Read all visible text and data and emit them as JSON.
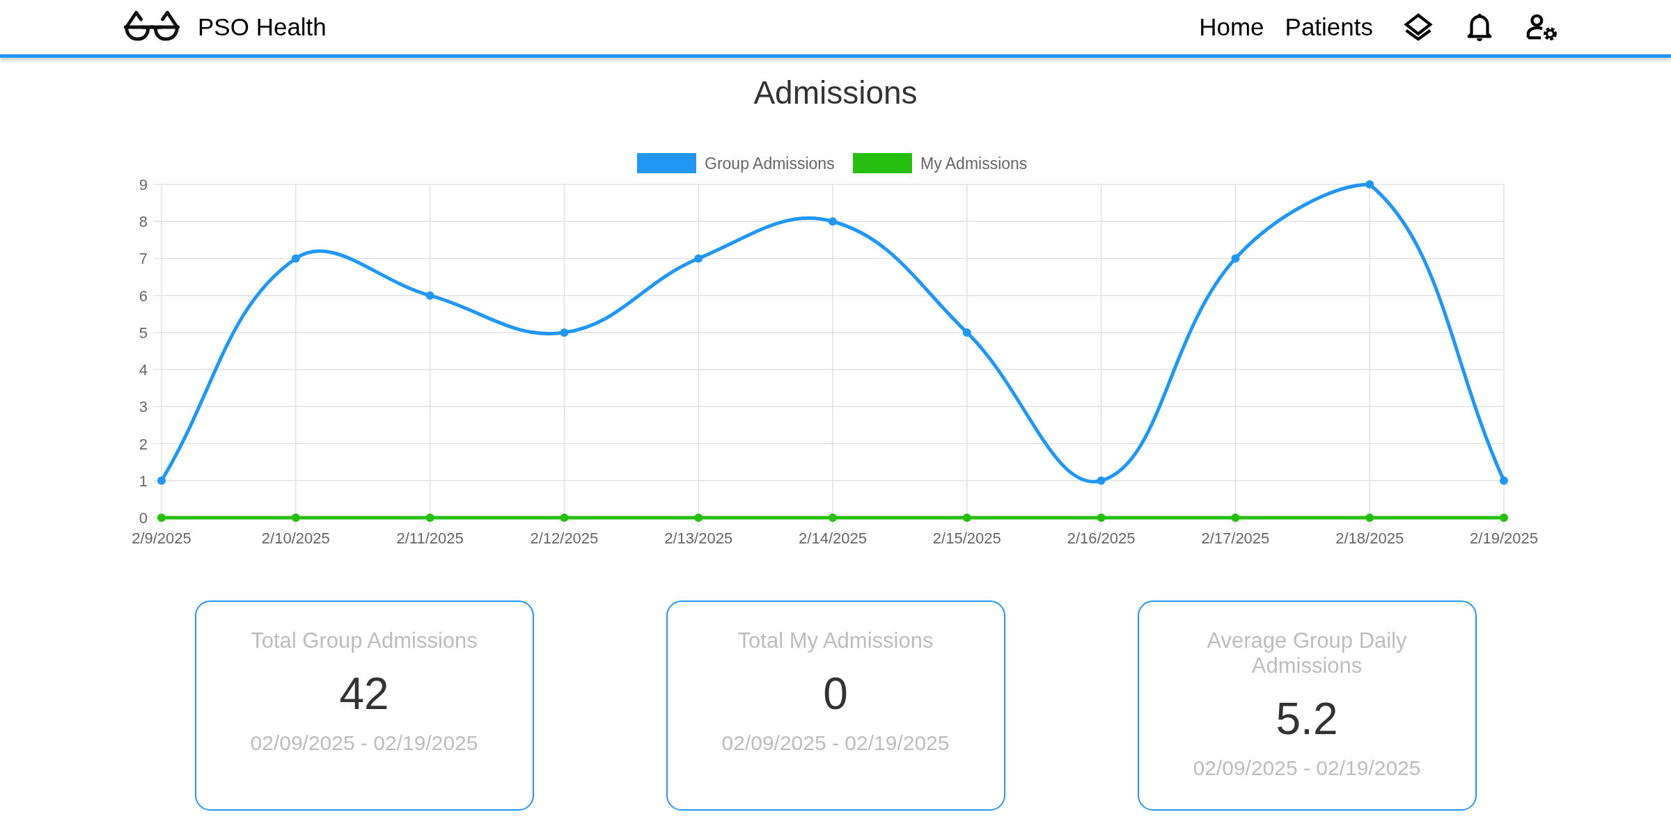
{
  "header": {
    "brand": "PSO Health",
    "nav": [
      {
        "label": "Home"
      },
      {
        "label": "Patients"
      }
    ],
    "icons": [
      {
        "kind": "layers"
      },
      {
        "kind": "bell"
      },
      {
        "kind": "user-settings"
      }
    ]
  },
  "title": "Admissions",
  "chart_data": {
    "type": "line",
    "grid": true,
    "legend": true,
    "categories": [
      "2/9/2025",
      "2/10/2025",
      "2/11/2025",
      "2/12/2025",
      "2/13/2025",
      "2/14/2025",
      "2/15/2025",
      "2/16/2025",
      "2/17/2025",
      "2/18/2025",
      "2/19/2025"
    ],
    "ylim": [
      0,
      9
    ],
    "yticks": [
      0,
      1,
      2,
      3,
      4,
      5,
      6,
      7,
      8,
      9
    ],
    "series": [
      {
        "name": "Group Admissions",
        "color": "#2196f3",
        "marker": true,
        "values": [
          1,
          7,
          6,
          5,
          7,
          8,
          5,
          1,
          7,
          9,
          1
        ]
      },
      {
        "name": "My Admissions",
        "color": "#26be0f",
        "marker": true,
        "values": [
          0,
          0,
          0,
          0,
          0,
          0,
          0,
          0,
          0,
          0,
          0
        ]
      }
    ]
  },
  "cards": [
    {
      "title": "Total Group Admissions",
      "value": "42",
      "range": "02/09/2025 - 02/19/2025"
    },
    {
      "title": "Total My Admissions",
      "value": "0",
      "range": "02/09/2025 - 02/19/2025"
    },
    {
      "title": "Average Group Daily Admissions",
      "value": "5.2",
      "range": "02/09/2025 - 02/19/2025"
    }
  ]
}
